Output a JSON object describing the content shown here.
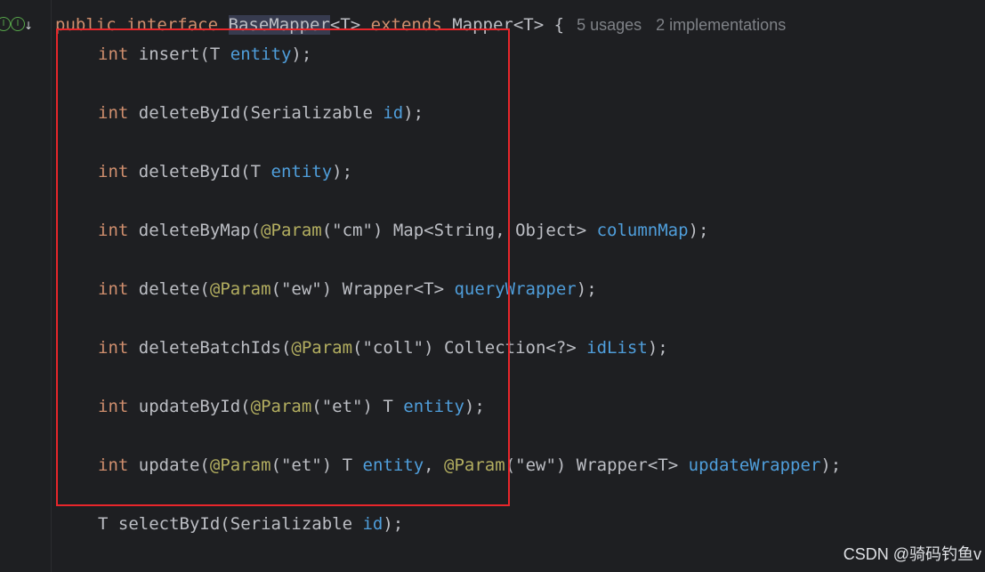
{
  "header_line": {
    "kw1": "public",
    "kw2": "interface",
    "name": "BaseMapper",
    "generic": "<T>",
    "kw3": "extends",
    "parent": "Mapper<T>",
    "brace": "{",
    "usages": "5 usages",
    "implementations": "2 implementations"
  },
  "methods": [
    {
      "ret": "int",
      "name": "insert",
      "open": "(",
      "ptype": "T ",
      "pname": "entity",
      "close": ");"
    },
    {
      "ret": "int",
      "name": "deleteById",
      "open": "(",
      "ptype": "Serializable ",
      "pname": "id",
      "close": ");"
    },
    {
      "ret": "int",
      "name": "deleteById",
      "open": "(",
      "ptype": "T ",
      "pname": "entity",
      "close": ");"
    },
    {
      "ret": "int",
      "name": "deleteByMap",
      "open": "(",
      "ann": "@Param",
      "ann_open": "(",
      "ann_str": "\"cm\"",
      "ann_close": ") ",
      "ptype": "Map<String, Object> ",
      "pname": "columnMap",
      "close": ");"
    },
    {
      "ret": "int",
      "name": "delete",
      "open": "(",
      "ann": "@Param",
      "ann_open": "(",
      "ann_str": "\"ew\"",
      "ann_close": ") ",
      "ptype": "Wrapper<T> ",
      "pname": "queryWrapper",
      "close": ");"
    },
    {
      "ret": "int",
      "name": "deleteBatchIds",
      "open": "(",
      "ann": "@Param",
      "ann_open": "(",
      "ann_str": "\"coll\"",
      "ann_close": ") ",
      "ptype": "Collection<?> ",
      "pname": "idList",
      "close": ");"
    },
    {
      "ret": "int",
      "name": "updateById",
      "open": "(",
      "ann": "@Param",
      "ann_open": "(",
      "ann_str": "\"et\"",
      "ann_close": ") ",
      "ptype": "T ",
      "pname": "entity",
      "close": ");"
    },
    {
      "ret": "int",
      "name": "update",
      "open": "(",
      "ann": "@Param",
      "ann_open": "(",
      "ann_str": "\"et\"",
      "ann_close": ") ",
      "ptype": "T ",
      "pname": "entity",
      "sep": ", ",
      "ann2": "@Param",
      "ann2_open": "(",
      "ann2_str": "\"ew\"",
      "ann2_close": ") ",
      "ptype2": "Wrapper<T> ",
      "pname2": "updateWrapper",
      "close": ");"
    },
    {
      "ret": "T",
      "name": "selectById",
      "open": "(",
      "ptype": "Serializable ",
      "pname": "id",
      "close": ");"
    }
  ],
  "gutter_icons": [
    "implemented-interface-icon",
    "interface-icon",
    "down-arrow-icon"
  ],
  "gutter_icon_glyphs": [
    "I",
    "I",
    "↓"
  ],
  "watermark": "CSDN @骑码钓鱼v",
  "colors": {
    "keyword": "#cf8e6d",
    "param": "#56a8f5",
    "annotation": "#b3ae60",
    "highlight_box": "#e8262b"
  }
}
